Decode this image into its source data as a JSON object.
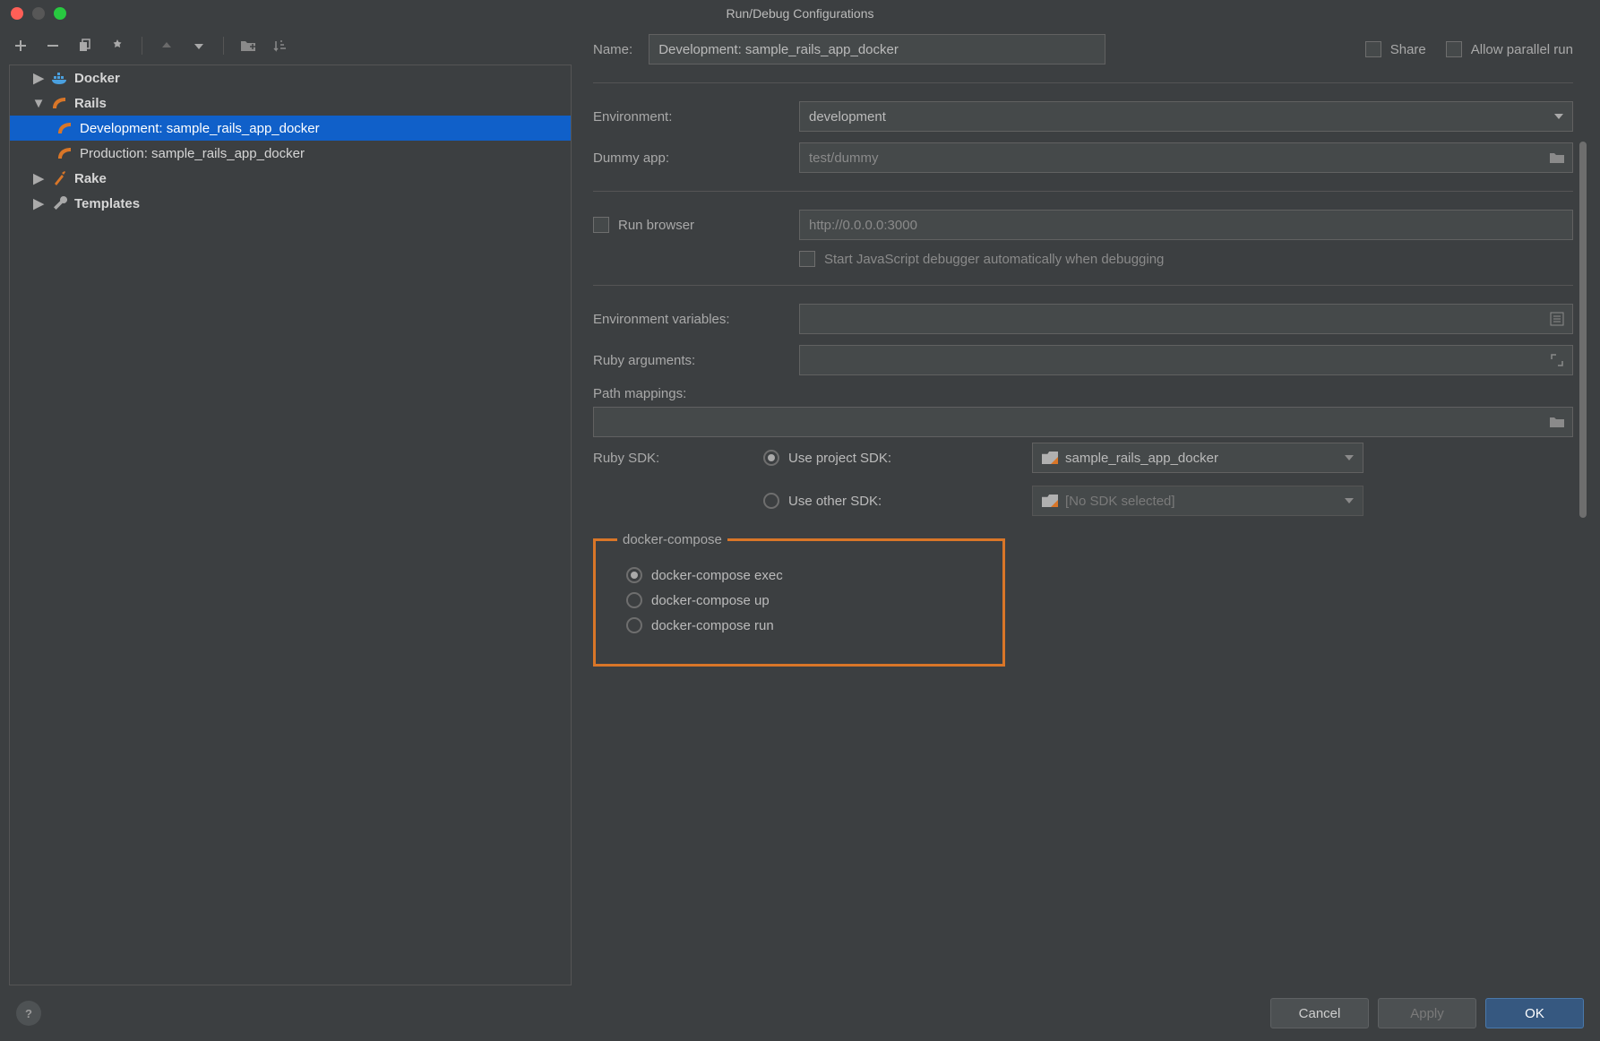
{
  "window": {
    "title": "Run/Debug Configurations"
  },
  "tree": {
    "docker_label": "Docker",
    "rails_label": "Rails",
    "rails_items": [
      {
        "label": "Development: sample_rails_app_docker",
        "selected": true
      },
      {
        "label": "Production: sample_rails_app_docker",
        "selected": false
      }
    ],
    "rake_label": "Rake",
    "templates_label": "Templates"
  },
  "form": {
    "name_label": "Name:",
    "name_value": "Development: sample_rails_app_docker",
    "share_label": "Share",
    "allow_parallel_label": "Allow parallel run",
    "environment_label": "Environment:",
    "environment_value": "development",
    "dummy_app_label": "Dummy app:",
    "dummy_app_value": "test/dummy",
    "run_browser_label": "Run browser",
    "run_browser_url": "http://0.0.0.0:3000",
    "start_js_debugger_label": "Start JavaScript debugger automatically when debugging",
    "env_vars_label": "Environment variables:",
    "ruby_args_label": "Ruby arguments:",
    "path_mappings_label": "Path mappings:",
    "ruby_sdk_label": "Ruby SDK:",
    "use_project_sdk_label": "Use project SDK:",
    "project_sdk_value": "sample_rails_app_docker",
    "use_other_sdk_label": "Use other SDK:",
    "other_sdk_value": "[No SDK selected]",
    "docker_compose_legend": "docker-compose",
    "compose_options": [
      {
        "label": "docker-compose exec",
        "selected": true
      },
      {
        "label": "docker-compose up",
        "selected": false
      },
      {
        "label": "docker-compose run",
        "selected": false
      }
    ]
  },
  "footer": {
    "cancel": "Cancel",
    "apply": "Apply",
    "ok": "OK"
  }
}
